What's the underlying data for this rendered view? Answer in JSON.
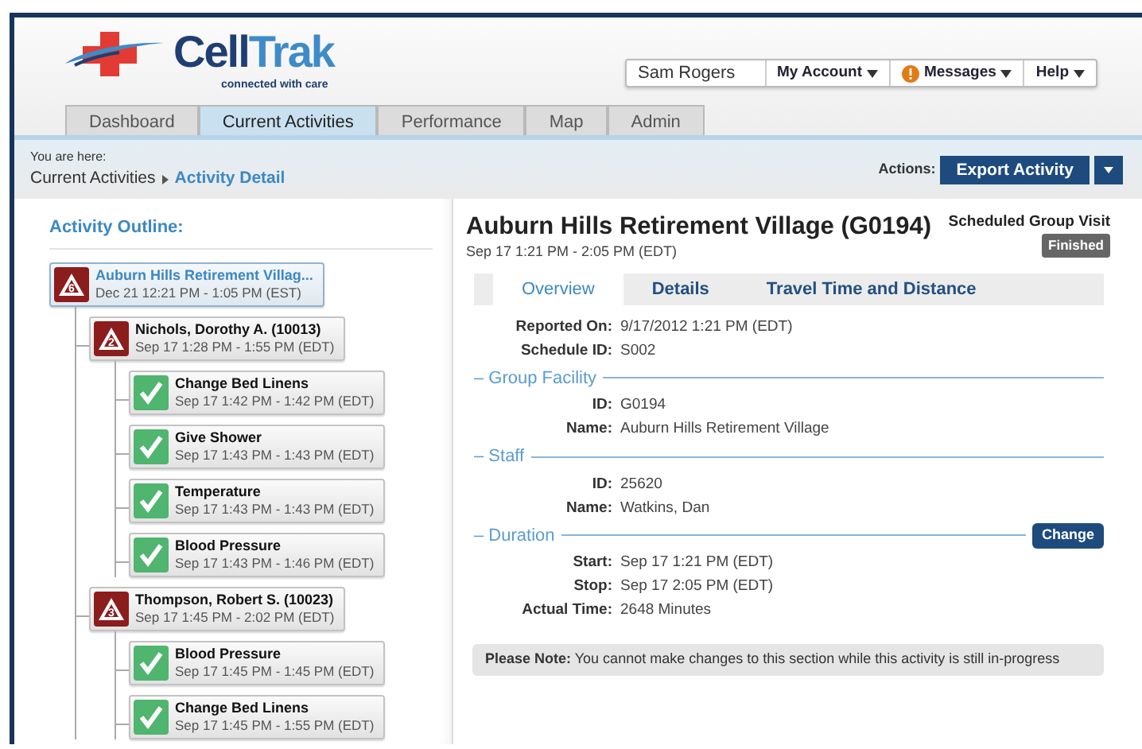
{
  "brand": {
    "name_a": "Cell",
    "name_b": "Trak",
    "tagline": "connected with care"
  },
  "user_menu": {
    "user": "Sam Rogers",
    "items": [
      {
        "label": "My Account",
        "kind": "plain"
      },
      {
        "label": "Messages",
        "kind": "alert"
      },
      {
        "label": "Help",
        "kind": "plain"
      }
    ]
  },
  "tabs": [
    {
      "label": "Dashboard",
      "selected": false
    },
    {
      "label": "Current Activities",
      "selected": true
    },
    {
      "label": "Performance",
      "selected": false
    },
    {
      "label": "Map",
      "selected": false
    },
    {
      "label": "Admin",
      "selected": false
    }
  ],
  "breadcrumb": {
    "prefix": "You are here:",
    "items": [
      "Current Activities",
      "Activity Detail"
    ]
  },
  "actions": {
    "label": "Actions:",
    "button": "Export Activity"
  },
  "outline": {
    "title": "Activity Outline:",
    "tree": [
      {
        "kind": "alert",
        "count": "6",
        "title": "Auburn Hills Retirement Villag...",
        "time": "Dec 21 12:21 PM - 1:05 PM (EST)",
        "selected": true,
        "children": [
          {
            "kind": "alert",
            "count": "2",
            "title": "Nichols, Dorothy A. (10013)",
            "time": "Sep 17 1:28 PM - 1:55 PM (EDT)",
            "selected": false,
            "children": [
              {
                "kind": "done",
                "title": "Change Bed Linens",
                "time": "Sep 17 1:42 PM - 1:42 PM (EDT)",
                "selected": false
              },
              {
                "kind": "done",
                "title": "Give Shower",
                "time": "Sep 17 1:43 PM - 1:43 PM (EDT)",
                "selected": false
              },
              {
                "kind": "done",
                "title": "Temperature",
                "time": "Sep 17 1:43 PM - 1:43 PM (EDT)",
                "selected": false
              },
              {
                "kind": "done",
                "title": "Blood Pressure",
                "time": "Sep 17 1:43 PM - 1:46 PM (EDT)",
                "selected": false
              }
            ]
          },
          {
            "kind": "alert",
            "count": "3",
            "title": "Thompson, Robert S. (10023)",
            "time": "Sep 17 1:45 PM - 2:02 PM (EDT)",
            "selected": false,
            "children": [
              {
                "kind": "done",
                "title": "Blood Pressure",
                "time": "Sep 17 1:45 PM - 1:45 PM (EDT)",
                "selected": false
              },
              {
                "kind": "done",
                "title": "Change Bed Linens",
                "time": "Sep 17 1:45 PM - 1:55 PM (EDT)",
                "selected": false
              }
            ]
          }
        ]
      }
    ]
  },
  "detail": {
    "title": "Auburn Hills Retirement Village (G0194)",
    "subtitle": "Sep 17 1:21 PM - 2:05 PM (EDT)",
    "type": "Scheduled Group Visit",
    "status": "Finished",
    "tabs": [
      {
        "label": "Overview",
        "selected": true
      },
      {
        "label": "Details",
        "selected": false
      },
      {
        "label": "Travel Time and Distance",
        "selected": false
      }
    ],
    "sections": [
      {
        "fields": [
          {
            "label": "Reported On:",
            "value": "9/17/2012 1:21 PM (EDT)"
          },
          {
            "label": "Schedule ID:",
            "value": "S002"
          }
        ]
      },
      {
        "legend": "– Group Facility",
        "fields": [
          {
            "label": "ID:",
            "value": "G0194"
          },
          {
            "label": "Name:",
            "value": "Auburn Hills Retirement Village"
          }
        ]
      },
      {
        "legend": "– Staff",
        "fields": [
          {
            "label": "ID:",
            "value": "25620"
          },
          {
            "label": "Name:",
            "value": "Watkins, Dan"
          }
        ]
      },
      {
        "legend": "– Duration",
        "button": "Change",
        "fields": [
          {
            "label": "Start:",
            "value": "Sep 17 1:21 PM (EDT)"
          },
          {
            "label": "Stop:",
            "value": "Sep 17 2:05 PM (EDT)"
          },
          {
            "label": "Actual Time:",
            "value": "2648 Minutes"
          }
        ]
      }
    ],
    "note": "**Please Note:** You cannot make changes to this section while this activity is still in-progress"
  }
}
